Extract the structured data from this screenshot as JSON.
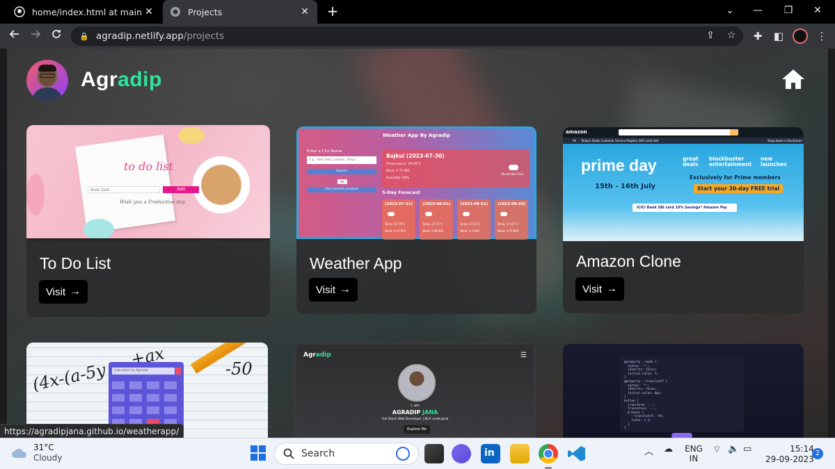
{
  "browser": {
    "tabs": [
      {
        "title": "home/index.html at main · Agradip",
        "icon": "github-icon",
        "active": false
      },
      {
        "title": "Projects",
        "icon": "globe-icon",
        "active": true
      }
    ],
    "url_host": "agradip.netlify.app",
    "url_path": "/projects",
    "status_link": "https://agradipjana.github.io/weatherapp/"
  },
  "site": {
    "logo_main": "Agr",
    "logo_accent": "adip",
    "accent_color": "#2ee59d"
  },
  "projects": [
    {
      "title": "To Do List",
      "visit_label": "Visit",
      "arrow": "→"
    },
    {
      "title": "Weather App",
      "visit_label": "Visit",
      "arrow": "→"
    },
    {
      "title": "Amazon Clone",
      "visit_label": "Visit",
      "arrow": "→"
    }
  ],
  "thumbs": {
    "todo": {
      "title": "to do list",
      "placeholder": "New task",
      "add": "Add",
      "wish": "Wish you a Productive day"
    },
    "weather": {
      "header": "Weather App By Agradip",
      "label": "Enter a City Name",
      "placeholder": "E.g., New York, London, Tokyo",
      "search": "Search",
      "or": "or",
      "current": "Use Current Location",
      "city": "Bajkul (2023-07-30)",
      "temp": "Temperature: 29.09°C",
      "wind": "Wind: 2.72 M/S",
      "humidity": "Humidity: 84%",
      "condition": "Moderate Rain",
      "forecast_title": "5-Day Forecast",
      "days": [
        {
          "date": "(2023-07-31)",
          "temp": "Temp: 27.79°C",
          "wind": "Wind: 2.57 M/S"
        },
        {
          "date": "(2023-08-01)",
          "temp": "Temp: 27.75°C",
          "wind": "Wind: 2.86 M/S"
        },
        {
          "date": "(2023-08-02)",
          "temp": "Temp: 27.15°C",
          "wind": "Wind: 3.2 M/S"
        },
        {
          "date": "(2023-08-03)",
          "temp": "Temp: 27.07°C",
          "wind": "Wind: 4.75 M/S"
        }
      ]
    },
    "amazon": {
      "logo": "amazon",
      "search_placeholder": "Search Amazon",
      "nav_all": "All",
      "nav_items": "Today's Deals   Customer Service   Registry   Gift Cards   Sell",
      "nav_right": "Shop deals in Electronics",
      "prime": "prime day",
      "dates": "15th - 16th July",
      "tag1": "great deals",
      "tag2": "blockbuster entertainment",
      "tag3": "new launches",
      "exclusive": "Exclusively for Prime members",
      "cta": "Start your 30-day FREE trial",
      "bank": "ICICI Bank   SBI card   10% Savings*   Amazon Pay"
    },
    "calculator": {
      "screen": "Calculator by Agradip",
      "math1": "(4x-(a-5y",
      "math2": "+ax",
      "math3": "-50"
    },
    "portfolio": {
      "logo_main": "Agr",
      "logo_accent": "adip",
      "iam": "I, am",
      "name_main": "AGRADIP",
      "name_accent": "JANA",
      "role": "Full Stack Web Developer  |  BCA undergrad",
      "explore": "Explore Me"
    },
    "code": {
      "lines": [
        "@property --mode {",
        "  syntax: '*';",
        "  inherits: false;",
        "  initial-value: 1;",
        "}",
        "@property --translateY {",
        "  syntax: '*';",
        "  inherits: false;",
        "  initial-value: 0px;",
        "}",
        "button {",
        "  transform: ...;",
        "  transition: ...;",
        "  &:hover {",
        "    --translateY: -6%;",
        "    scale: 1.1;",
        "  }",
        "}"
      ]
    }
  },
  "taskbar": {
    "temp": "31°C",
    "condition": "Cloudy",
    "search": "Search",
    "lang1": "ENG",
    "lang2": "IN",
    "time": "15:14",
    "date": "29-09-2023",
    "notifications": "2"
  }
}
